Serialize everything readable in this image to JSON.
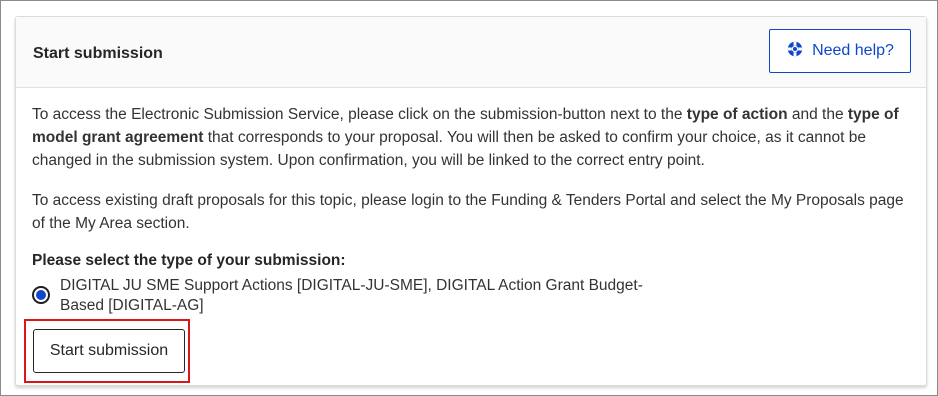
{
  "card": {
    "title": "Start submission",
    "help_button": {
      "label": "Need help?",
      "icon": "lifebuoy-icon"
    },
    "intro_parts": [
      "To access the Electronic Submission Service, please click on the submission-button next to the ",
      "type of action",
      " and the ",
      "type of model grant agreement",
      " that corresponds to your proposal. You will then be asked to confirm your choice, as it cannot be changed in the submission system. Upon confirmation, you will be linked to the correct entry point."
    ],
    "drafts_text": "To access existing draft proposals for this topic, please login to the Funding & Tenders Portal and select the My Proposals page of the My Area section.",
    "select_heading": "Please select the type of your submission:",
    "option": {
      "label": "DIGITAL JU SME Support Actions [DIGITAL-JU-SME], DIGITAL Action Grant Budget-Based [DIGITAL-AG]",
      "selected": true
    },
    "submit_button": "Start submission"
  },
  "colors": {
    "accent": "#0e47cb",
    "highlight_border": "#d9161c",
    "text": "#333333"
  }
}
